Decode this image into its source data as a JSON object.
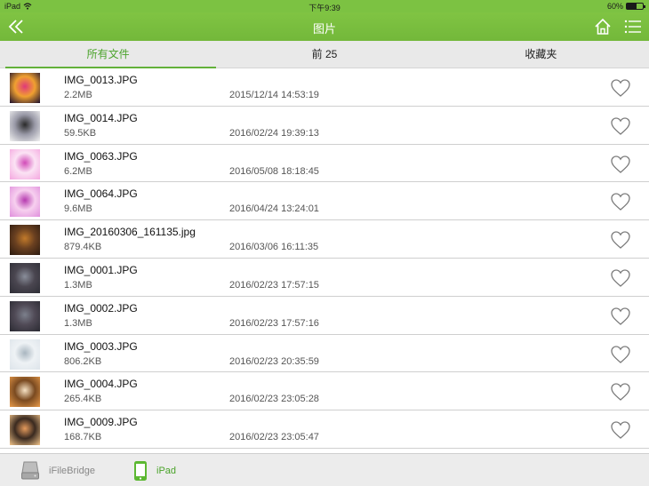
{
  "status_bar": {
    "device": "iPad",
    "time": "下午9:39",
    "battery": "60%",
    "battery_level": 0.6
  },
  "header": {
    "title": "图片",
    "back_icon": "double-chevron-left-icon",
    "home_icon": "home-icon",
    "menu_icon": "menu-icon"
  },
  "tabs": [
    {
      "label": "所有文件",
      "active": true
    },
    {
      "label": "前 25",
      "active": false
    },
    {
      "label": "收藏夹",
      "active": false
    }
  ],
  "files": [
    {
      "name": "IMG_0013.JPG",
      "size": "2.2MB",
      "date": "2015/12/14 14:53:19",
      "thumb_colors": [
        "#1a0f2e",
        "#e0387a",
        "#f0a030"
      ]
    },
    {
      "name": "IMG_0014.JPG",
      "size": "59.5KB",
      "date": "2016/02/24 19:39:13",
      "thumb_colors": [
        "#f2f2f2",
        "#2a2a2a",
        "#9a9aa8"
      ]
    },
    {
      "name": "IMG_0063.JPG",
      "size": "6.2MB",
      "date": "2016/05/08 18:18:45",
      "thumb_colors": [
        "#f4a6df",
        "#d24bb8",
        "#fbe3f4"
      ]
    },
    {
      "name": "IMG_0064.JPG",
      "size": "9.6MB",
      "date": "2016/04/24 13:24:01",
      "thumb_colors": [
        "#e08fdc",
        "#b63bb0",
        "#f7d0ef"
      ]
    },
    {
      "name": "IMG_20160306_161135.jpg",
      "size": "879.4KB",
      "date": "2016/03/06 16:11:35",
      "thumb_colors": [
        "#2b1a10",
        "#c27a2a",
        "#6a4020"
      ]
    },
    {
      "name": "IMG_0001.JPG",
      "size": "1.3MB",
      "date": "2016/02/23 17:57:15",
      "thumb_colors": [
        "#2e2e36",
        "#8a8e9a",
        "#4a4650"
      ]
    },
    {
      "name": "IMG_0002.JPG",
      "size": "1.3MB",
      "date": "2016/02/23 17:57:16",
      "thumb_colors": [
        "#2a2a32",
        "#7c808c",
        "#504a56"
      ]
    },
    {
      "name": "IMG_0003.JPG",
      "size": "806.2KB",
      "date": "2016/02/23 20:35:59",
      "thumb_colors": [
        "#dde4ea",
        "#a9b6c0",
        "#eef2f5"
      ]
    },
    {
      "name": "IMG_0004.JPG",
      "size": "265.4KB",
      "date": "2016/02/23 23:05:28",
      "thumb_colors": [
        "#e89a4a",
        "#f6e2c4",
        "#7a4a20"
      ]
    },
    {
      "name": "IMG_0009.JPG",
      "size": "168.7KB",
      "date": "2016/02/23 23:05:47",
      "thumb_colors": [
        "#f3c58a",
        "#e49a5c",
        "#3a2a20"
      ]
    }
  ],
  "heart_icon": "heart-outline-icon",
  "bottom_bar": {
    "drive_label": "iFileBridge",
    "drive_icon": "drive-icon",
    "ipad_label": "iPad",
    "ipad_icon": "phone-icon"
  },
  "colors": {
    "accent": "#7cc242",
    "active_text": "#4aa32a"
  }
}
